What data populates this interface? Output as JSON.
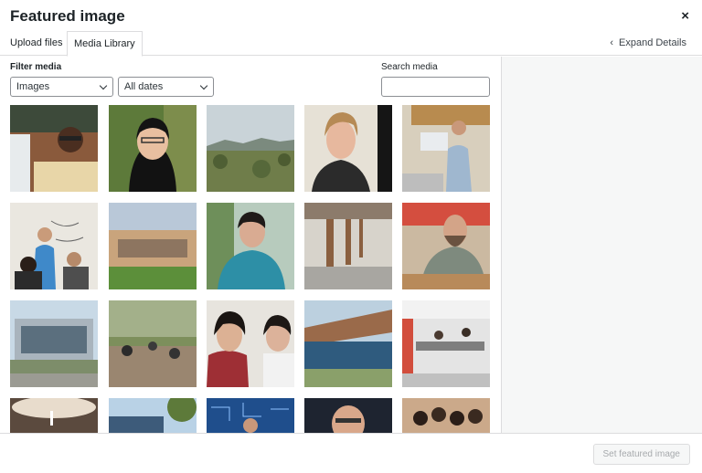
{
  "modal": {
    "title": "Featured image",
    "close_icon": "×"
  },
  "tabs": [
    {
      "label": "Upload files",
      "active": false
    },
    {
      "label": "Media Library",
      "active": true
    }
  ],
  "expand_details": {
    "label": "Expand Details",
    "icon": "chevron-left-icon"
  },
  "filters": {
    "label": "Filter media",
    "type_selected": "Images",
    "date_selected": "All dates"
  },
  "search": {
    "label": "Search media",
    "value": "",
    "placeholder": ""
  },
  "footer": {
    "set_button_label": "Set featured image"
  }
}
